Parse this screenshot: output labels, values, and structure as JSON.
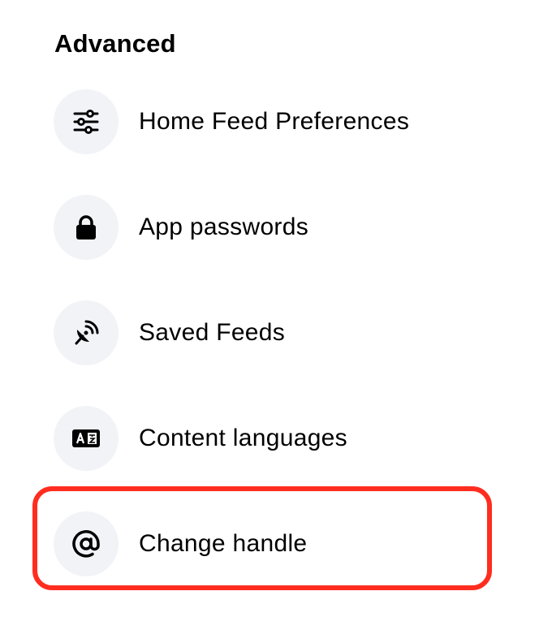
{
  "section": {
    "title": "Advanced"
  },
  "items": [
    {
      "label": "Home Feed Preferences",
      "icon": "sliders-icon"
    },
    {
      "label": "App passwords",
      "icon": "lock-icon"
    },
    {
      "label": "Saved Feeds",
      "icon": "satellite-dish-icon"
    },
    {
      "label": "Content languages",
      "icon": "language-icon"
    },
    {
      "label": "Change handle",
      "icon": "at-sign-icon"
    }
  ],
  "colors": {
    "icon_background": "#f1f3f7",
    "highlight": "#ff2d1f",
    "text": "#000000"
  }
}
